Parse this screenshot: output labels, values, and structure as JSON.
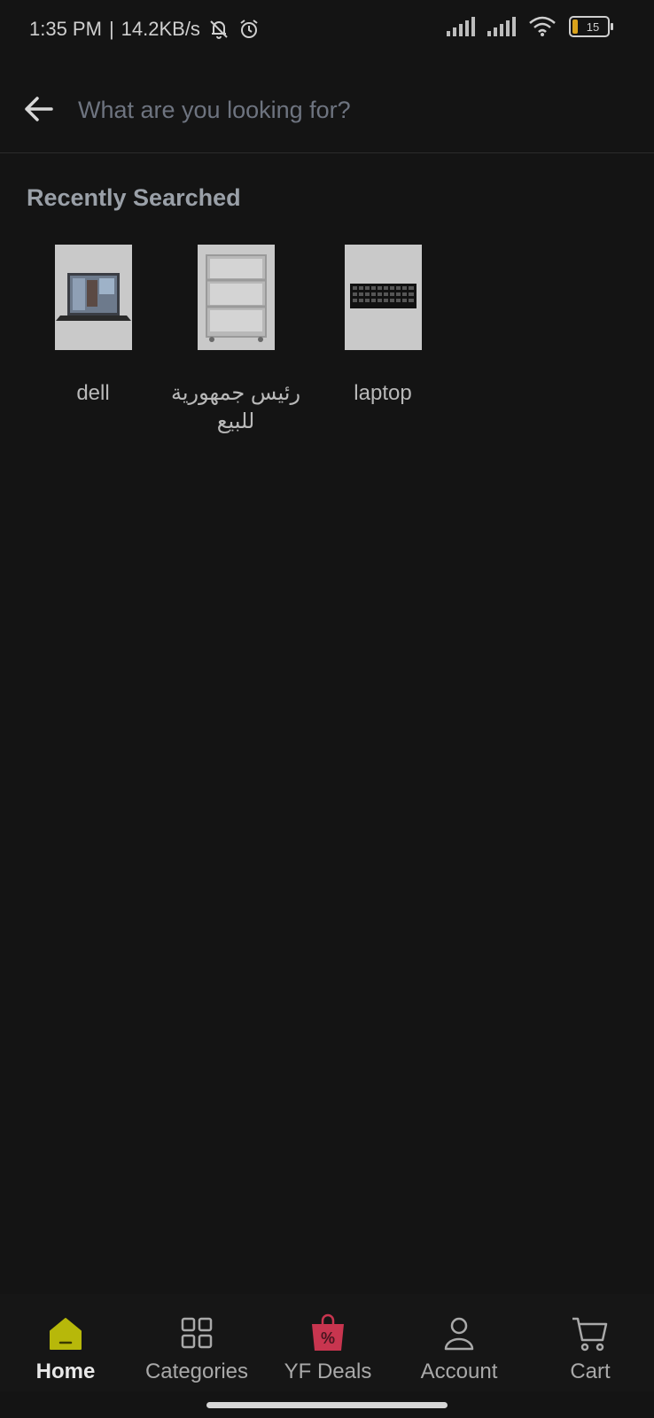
{
  "status_bar": {
    "time": "1:35 PM",
    "network_speed": "14.2KB/s",
    "battery_level": "15",
    "icons": [
      "bell-muted-icon",
      "alarm-icon",
      "signal-icon",
      "signal-icon",
      "wifi-icon",
      "battery-icon"
    ]
  },
  "search": {
    "placeholder": "What are you looking for?",
    "back_icon": "arrow-left-icon"
  },
  "recent": {
    "title": "Recently Searched",
    "items": [
      {
        "label": "dell",
        "image": "laptop-thumbnail"
      },
      {
        "label": "رئيس جمهورية للبيع",
        "image": "shelf-thumbnail"
      },
      {
        "label": "laptop",
        "image": "keyboard-sticker-thumbnail"
      }
    ]
  },
  "bottom_nav": {
    "items": [
      {
        "label": "Home",
        "icon": "home-icon",
        "active": true
      },
      {
        "label": "Categories",
        "icon": "grid-icon"
      },
      {
        "label": "YF Deals",
        "icon": "deals-bag-icon"
      },
      {
        "label": "Account",
        "icon": "user-icon"
      },
      {
        "label": "Cart",
        "icon": "cart-icon"
      }
    ]
  },
  "colors": {
    "background": "#141414",
    "home_accent": "#b7b80a",
    "deals_accent": "#c8354f"
  }
}
